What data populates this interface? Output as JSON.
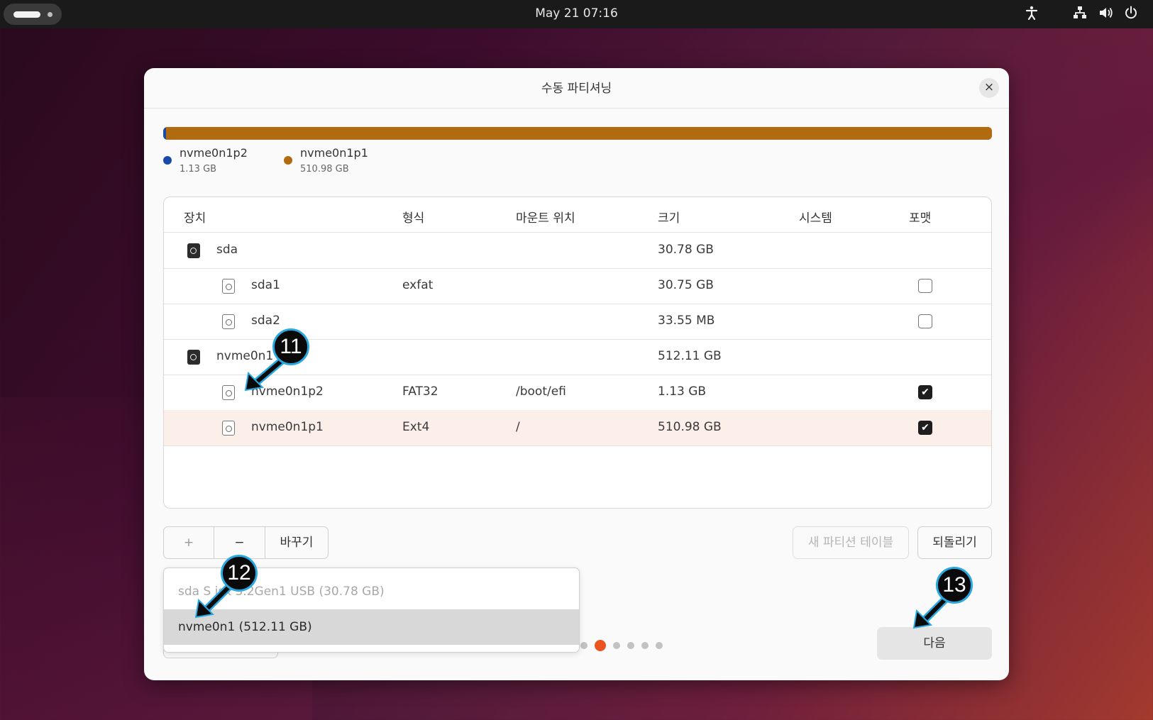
{
  "topbar": {
    "clock": "May 21  07:16",
    "tray_icons": [
      "accessibility-icon",
      "network-icon",
      "volume-icon",
      "power-icon"
    ]
  },
  "dialog": {
    "title": "수동 파티셔닝",
    "close_label": "×"
  },
  "partition_bar": {
    "segments": [
      {
        "name": "nvme0n1p2",
        "size": "1.13 GB",
        "color": "#1a4aa8"
      },
      {
        "name": "nvme0n1p1",
        "size": "510.98 GB",
        "color": "#b06a10"
      }
    ]
  },
  "table": {
    "headers": {
      "device": "장치",
      "type": "형식",
      "mount": "마운트 위치",
      "size": "크기",
      "system": "시스템",
      "format": "포맷"
    },
    "rows": [
      {
        "device": "sda",
        "type": "",
        "mount": "",
        "size": "30.78 GB",
        "kind": "disk",
        "format": null,
        "selected": false
      },
      {
        "device": "sda1",
        "type": "exfat",
        "mount": "",
        "size": "30.75 GB",
        "kind": "partition",
        "format": false,
        "selected": false
      },
      {
        "device": "sda2",
        "type": "",
        "mount": "",
        "size": "33.55 MB",
        "kind": "partition",
        "format": false,
        "selected": false
      },
      {
        "device": "nvme0n1",
        "type": "",
        "mount": "",
        "size": "512.11 GB",
        "kind": "disk",
        "format": null,
        "selected": false
      },
      {
        "device": "nvme0n1p2",
        "type": "FAT32",
        "mount": "/boot/efi",
        "size": "1.13 GB",
        "kind": "partition",
        "format": true,
        "selected": false
      },
      {
        "device": "nvme0n1p1",
        "type": "Ext4",
        "mount": "/",
        "size": "510.98 GB",
        "kind": "partition",
        "format": true,
        "selected": true
      }
    ]
  },
  "actions": {
    "add": "+",
    "remove": "−",
    "change": "바꾸기",
    "new_table": "새 파티션 테이블",
    "revert": "되돌리기",
    "next": "다음"
  },
  "bootloader_dropdown": {
    "options": [
      {
        "label": "sda SanDisk 3.2Gen1 USB (30.78 GB)",
        "visible_label": "sda  S     isk 3.2Gen1 USB (30.78 GB)",
        "highlighted": false
      },
      {
        "label": "nvme0n1  (512.11 GB)",
        "visible_label": "nvme0n1  (512.11 GB)",
        "highlighted": true
      }
    ]
  },
  "pager": {
    "total": 6,
    "active": 1
  },
  "callouts": [
    "11",
    "12",
    "13"
  ],
  "colors": {
    "accent": "#e95420",
    "callout_border": "#2aa8e0"
  }
}
